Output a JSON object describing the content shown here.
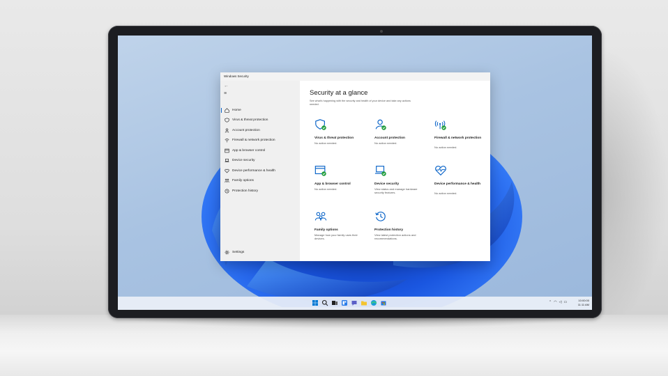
{
  "window": {
    "title": "Windows Security"
  },
  "sidebar": {
    "items": [
      {
        "label": "Home",
        "icon": "home-icon"
      },
      {
        "label": "Virus & threat protection",
        "icon": "shield-icon"
      },
      {
        "label": "Account protection",
        "icon": "person-icon"
      },
      {
        "label": "Firewall & network protection",
        "icon": "wifi-icon"
      },
      {
        "label": "App & browser control",
        "icon": "app-window-icon"
      },
      {
        "label": "Device security",
        "icon": "laptop-icon"
      },
      {
        "label": "Device performance & health",
        "icon": "heart-icon"
      },
      {
        "label": "Family options",
        "icon": "family-icon"
      },
      {
        "label": "Protection history",
        "icon": "history-icon"
      }
    ],
    "settings_label": "Settings"
  },
  "main": {
    "heading": "Security at a glance",
    "subheading": "See what's happening with the security and health of your device and take any actions needed.",
    "cards": [
      {
        "title": "Virus & threat protection",
        "status": "No action needed.",
        "icon": "shield-check-icon"
      },
      {
        "title": "Account protection",
        "status": "No action needed.",
        "icon": "person-check-icon"
      },
      {
        "title": "Firewall & network protection",
        "status": "No action needed.",
        "icon": "wifi-check-icon"
      },
      {
        "title": "App & browser control",
        "status": "No action needed.",
        "icon": "app-window-check-icon"
      },
      {
        "title": "Device security",
        "status": "View status and manage hardware security features.",
        "icon": "laptop-check-icon"
      },
      {
        "title": "Device performance & health",
        "status": "No action needed.",
        "icon": "heart-pulse-icon"
      },
      {
        "title": "Family options",
        "status": "Manage how your family uses their devices.",
        "icon": "family-icon"
      },
      {
        "title": "Protection history",
        "status": "View latest protection actions and recommendations.",
        "icon": "history-icon"
      }
    ]
  },
  "taskbar": {
    "clock_time": "10:00:00",
    "clock_date": "11:11 AM"
  },
  "colors": {
    "accent": "#0a64c8",
    "check": "#1f9d3a"
  }
}
